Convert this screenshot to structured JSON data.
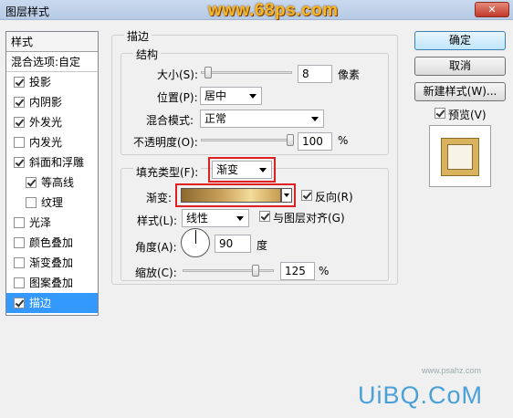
{
  "window": {
    "title": "图层样式",
    "watermark": "www.68ps.com",
    "close_label": "✕"
  },
  "left_panel": {
    "header": "样式",
    "blend_options": "混合选项:自定",
    "items": [
      {
        "label": "投影",
        "checked": true
      },
      {
        "label": "内阴影",
        "checked": true
      },
      {
        "label": "外发光",
        "checked": true
      },
      {
        "label": "内发光",
        "checked": false
      },
      {
        "label": "斜面和浮雕",
        "checked": true
      },
      {
        "label": "等高线",
        "checked": true
      },
      {
        "label": "纹理",
        "checked": false
      },
      {
        "label": "光泽",
        "checked": false
      },
      {
        "label": "颜色叠加",
        "checked": false
      },
      {
        "label": "渐变叠加",
        "checked": false
      },
      {
        "label": "图案叠加",
        "checked": false
      },
      {
        "label": "描边",
        "checked": true
      }
    ]
  },
  "stroke": {
    "section_title": "描边",
    "structure": {
      "title": "结构",
      "size_label": "大小(S):",
      "size_value": "8",
      "size_unit": "像素",
      "size_fraction": 0.02,
      "position_label": "位置(P):",
      "position_value": "居中",
      "blend_mode_label": "混合模式:",
      "blend_mode_value": "正常",
      "opacity_label": "不透明度(O):",
      "opacity_value": "100",
      "opacity_unit": "%",
      "opacity_fraction": 1.0
    },
    "fill": {
      "fill_type_label": "填充类型(F):",
      "fill_type_value": "渐变",
      "gradient_label": "渐变:",
      "reverse_label": "反向(R)",
      "reverse_checked": true,
      "style_label": "样式(L):",
      "style_value": "线性",
      "align_label": "与图层对齐(G)",
      "align_checked": true,
      "angle_label": "角度(A):",
      "angle_value": "90",
      "angle_unit": "度",
      "scale_label": "缩放(C):",
      "scale_value": "125",
      "scale_unit": "%",
      "scale_fraction": 0.8
    }
  },
  "right_panel": {
    "ok_label": "确定",
    "cancel_label": "取消",
    "new_style_label": "新建样式(W)...",
    "preview_label": "预览(V)",
    "preview_checked": true
  },
  "footer": {
    "watermark": "UiBQ.CoM",
    "watermark_url": "www.psahz.com"
  }
}
